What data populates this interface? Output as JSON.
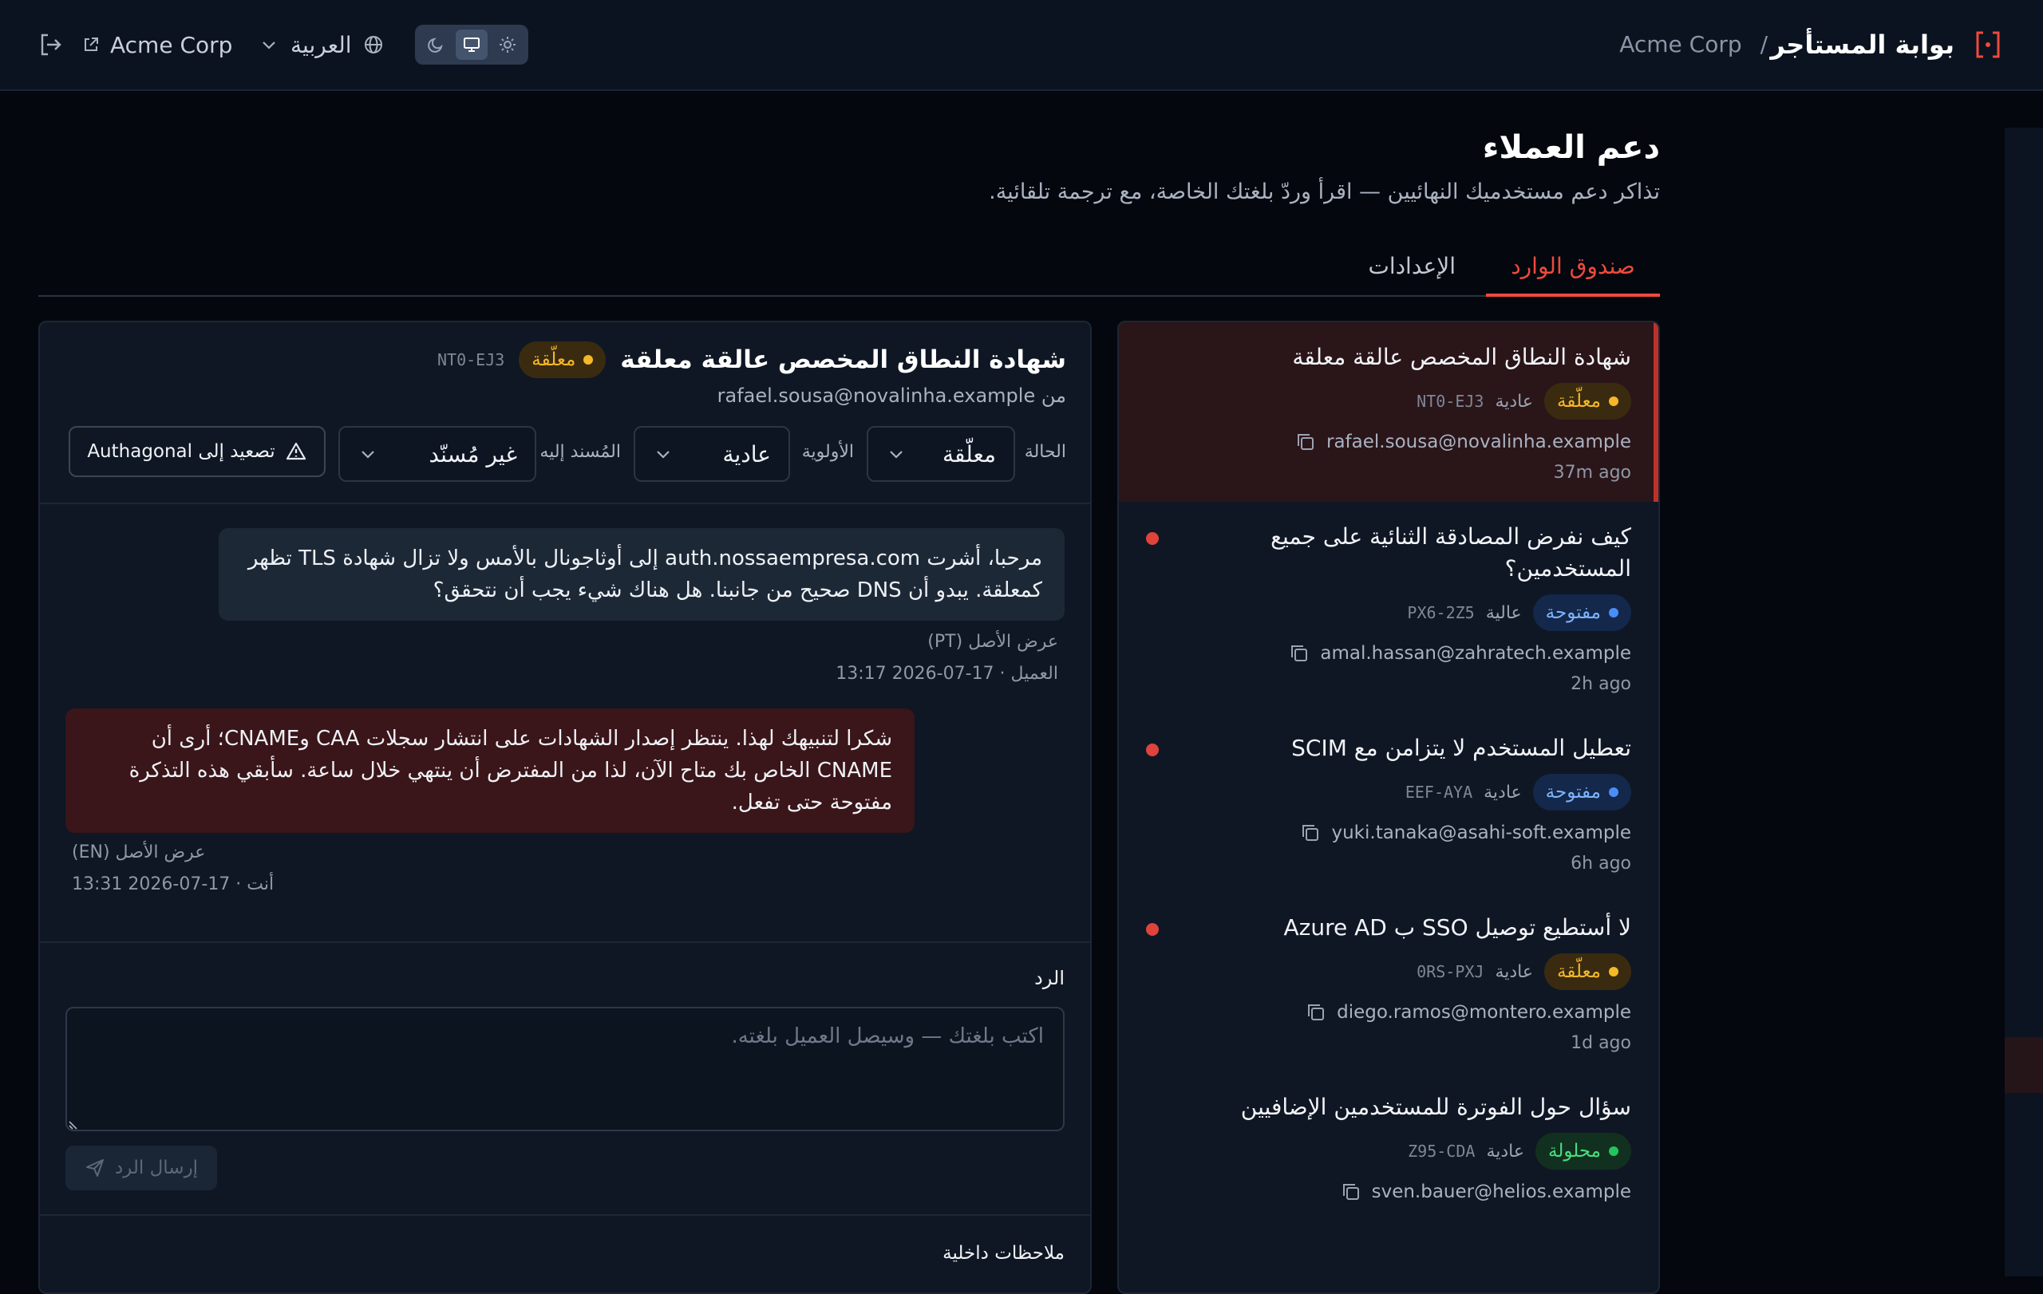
{
  "app": {
    "title": "بوابة المستأجر",
    "breadcrumb_sep": "/",
    "tenant": "Acme Corp",
    "language": "العربية",
    "logo_icon": "bracket-dot-icon"
  },
  "header_controls": {
    "tenant_link_label": "Acme Corp",
    "theme_options": [
      "dark",
      "system",
      "light"
    ],
    "theme_selected": "system"
  },
  "page": {
    "title": "دعم العملاء",
    "subtitle": "تذاكر دعم مستخدميك النهائيين — اقرأ وردّ بلغتك الخاصة، مع ترجمة تلقائية."
  },
  "tabs": [
    {
      "label": "صندوق الوارد",
      "active": true
    },
    {
      "label": "الإعدادات",
      "active": false
    }
  ],
  "tickets": [
    {
      "title": "شهادة النطاق المخصص عالقة معلقة",
      "status": "معلّقة",
      "status_kind": "pending",
      "priority": "عادية",
      "id": "NT0-EJ3",
      "email": "rafael.sousa@novalinha.example",
      "time": "37m ago",
      "unread": false,
      "selected": true
    },
    {
      "title": "كيف نفرض المصادقة الثنائية على جميع المستخدمين؟",
      "status": "مفتوحة",
      "status_kind": "open",
      "priority": "عالية",
      "id": "PX6-2Z5",
      "email": "amal.hassan@zahratech.example",
      "time": "2h ago",
      "unread": true,
      "selected": false
    },
    {
      "title": "تعطيل المستخدم لا يتزامن مع SCIM",
      "status": "مفتوحة",
      "status_kind": "open",
      "priority": "عادية",
      "id": "EEF-AYA",
      "email": "yuki.tanaka@asahi-soft.example",
      "time": "6h ago",
      "unread": true,
      "selected": false
    },
    {
      "title": "لا أستطيع توصيل SSO ب Azure AD",
      "status": "معلّقة",
      "status_kind": "pending",
      "priority": "عادية",
      "id": "0RS-PXJ",
      "email": "diego.ramos@montero.example",
      "time": "1d ago",
      "unread": true,
      "selected": false
    },
    {
      "title": "سؤال حول الفوترة للمستخدمين الإضافيين",
      "status": "محلولة",
      "status_kind": "resolved",
      "priority": "عادية",
      "id": "Z95-CDA",
      "email": "sven.bauer@helios.example",
      "time": "",
      "unread": false,
      "selected": false
    }
  ],
  "detail": {
    "title": "شهادة النطاق المخصص عالقة معلقة",
    "status_badge": "معلّقة",
    "id": "NT0-EJ3",
    "from_label": "من",
    "from_email": "rafael.sousa@novalinha.example",
    "controls": {
      "status_label": "الحالة",
      "status_value": "معلّقة",
      "priority_label": "الأولوية",
      "priority_value": "عادية",
      "assignee_label": "المُسند إليه",
      "assignee_value": "غير مُسنّد",
      "escalate_label": "تصعيد إلى Authagonal"
    },
    "messages": [
      {
        "author": "customer",
        "text": "مرحبا، أشرت auth.nossaempresa.com إلى أوثاجونال بالأمس ولا تزال شهادة TLS تظهر كمعلقة. يبدو أن DNS صحيح من جانبنا. هل هناك شيء يجب أن نتحقق؟",
        "view_original": "عرض الأصل (PT)",
        "meta": "العميل · 17-07-2026 13:17"
      },
      {
        "author": "agent",
        "text": "شكرا لتنبيهك لهذا. ينتظر إصدار الشهادات على انتشار سجلات CAA وCNAME؛ أرى أن CNAME الخاص بك متاح الآن، لذا من المفترض أن ينتهي خلال ساعة. سأبقي هذه التذكرة مفتوحة حتى تفعل.",
        "view_original": "عرض الأصل (EN)",
        "meta": "أنت · 17-07-2026 13:31"
      }
    ],
    "reply": {
      "label": "الرد",
      "placeholder": "اكتب بلغتك — وسيصل العميل بلغته.",
      "send_label": "إرسال الرد"
    },
    "notes_label": "ملاحظات داخلية"
  },
  "colors": {
    "accent": "#ef4a3d",
    "pending": "#f5b828",
    "open": "#4b8df8",
    "resolved": "#22c55e",
    "background": "#04070d",
    "panel": "#0f1724"
  }
}
